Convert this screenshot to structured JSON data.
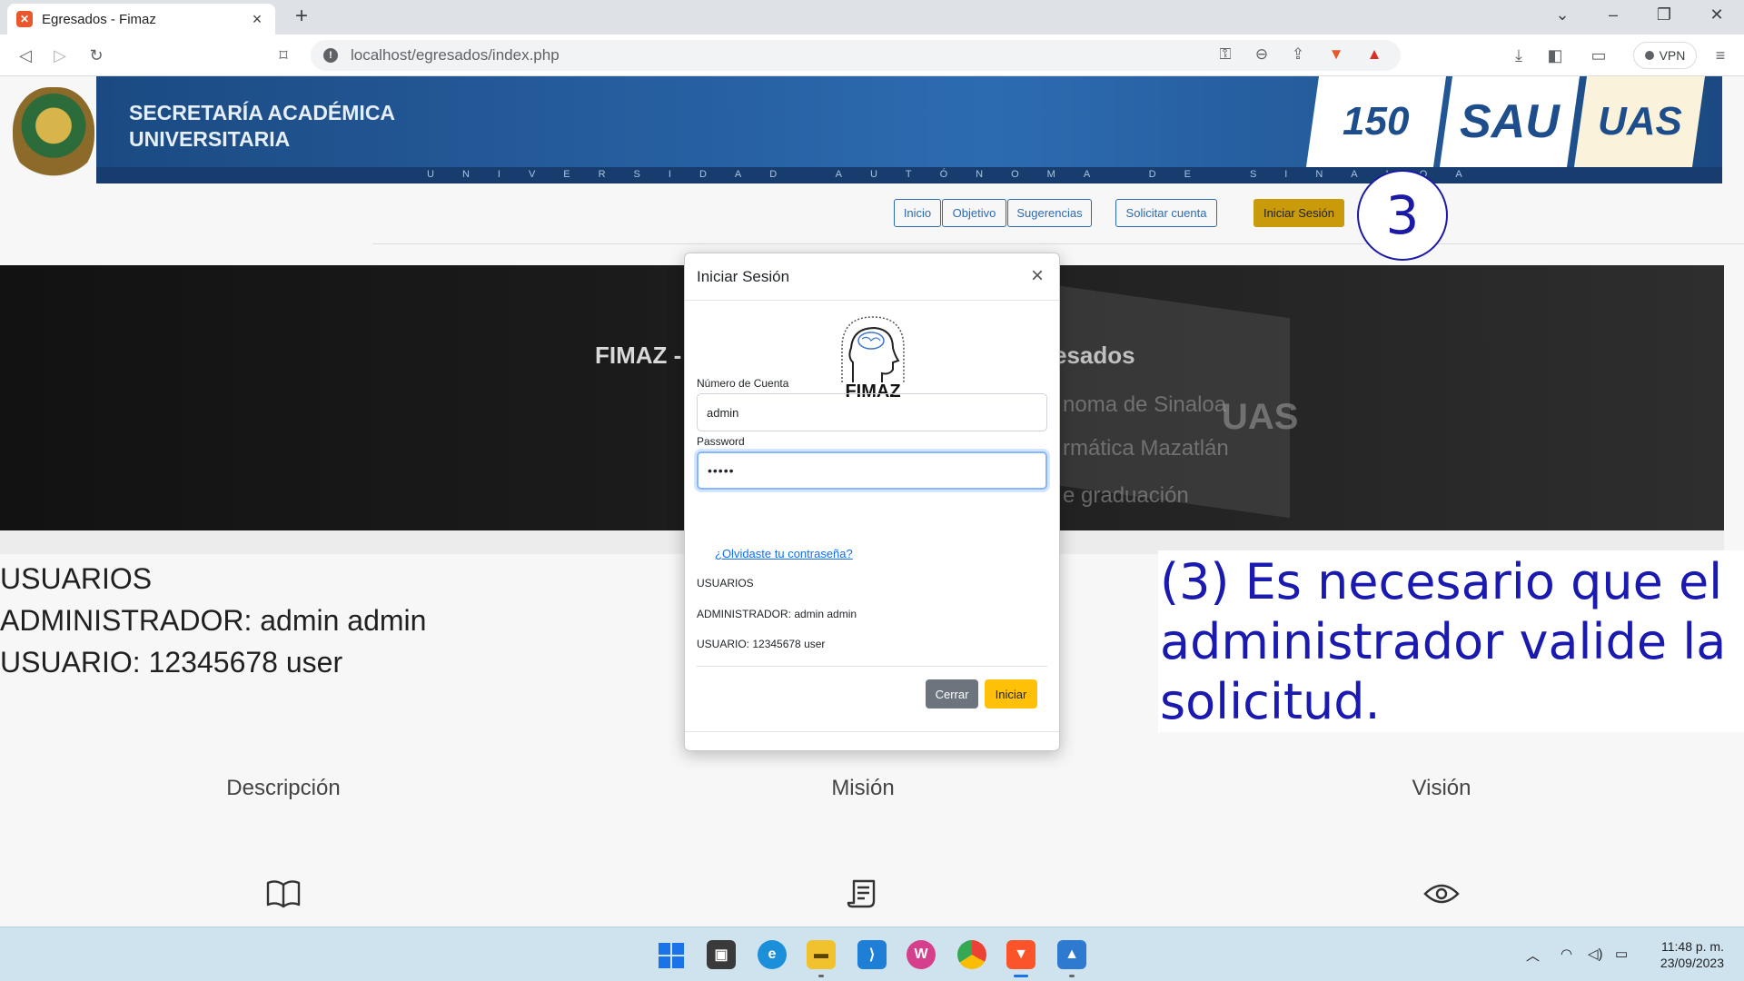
{
  "browser": {
    "tab_title": "Egresados - Fimaz",
    "tab_favicon": "xampp-icon",
    "url": "localhost/egresados/index.php",
    "vpn_label": "VPN"
  },
  "site": {
    "banner_title_line1": "SECRETARÍA ACADÉMICA",
    "banner_title_line2": "UNIVERSITARIA",
    "banner_strip": "UNIVERSIDAD AUTÓNOMA DE SINALOA",
    "logo_150": "150",
    "logo_sau": "SAU",
    "logo_uas": "UAS",
    "nav": {
      "inicio": "Inicio",
      "objetivo": "Objetivo",
      "sugerencias": "Sugerencias",
      "solicitar": "Solicitar cuenta",
      "iniciar": "Iniciar Sesión"
    },
    "hero_left": "FIMAZ -",
    "hero_right": "esados",
    "hero_photo_lines": [
      "noma de Sinaloa",
      "rmática Mazatlán",
      "e graduación"
    ],
    "hero_photo_logo": "UAS",
    "users": {
      "heading": "USUARIOS",
      "admin": "ADMINISTRADOR: admin admin",
      "user": "USUARIO: 12345678 user"
    },
    "sections": {
      "descripcion": "Descripción",
      "mision": "Misión",
      "vision": "Visión"
    }
  },
  "modal": {
    "title": "Iniciar Sesión",
    "logo_text": "FIMAZ",
    "account_label": "Número de Cuenta",
    "account_value": "admin",
    "password_label": "Password",
    "password_value": "•••••",
    "forgot": "¿Olvidaste tu contraseña?",
    "info_heading": "USUARIOS",
    "info_admin": "ADMINISTRADOR: admin admin",
    "info_user": "USUARIO: 12345678 user",
    "close_button": "Cerrar",
    "login_button": "Iniciar"
  },
  "overlay": {
    "step_number": "3",
    "note": "(3) Es necesario que el administrador valide la solicitud."
  },
  "taskbar": {
    "time": "11:48 p. m.",
    "date": "23/09/2023"
  },
  "colors": {
    "banner_blue": "#2d6bb1",
    "login_yellow": "#ffc107",
    "note_blue": "#1a1ab0"
  }
}
